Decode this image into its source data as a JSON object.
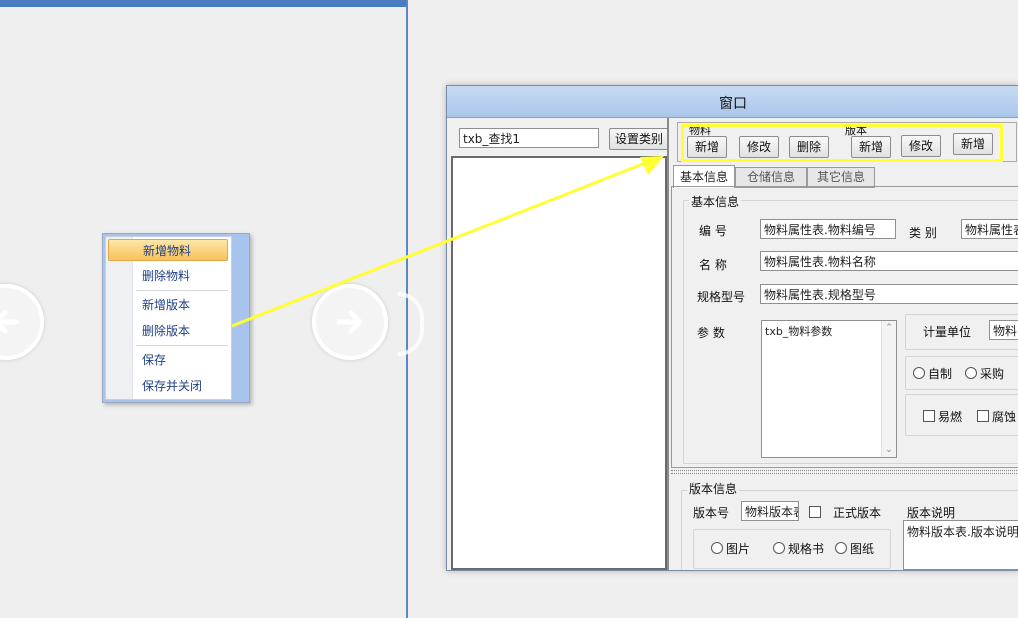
{
  "context_menu": {
    "items": [
      "新增物料",
      "删除物料",
      "新增版本",
      "删除版本",
      "保存",
      "保存并关闭"
    ]
  },
  "window": {
    "title": "窗口",
    "search_box": "txb_查找1",
    "set_category_button": "设置类别",
    "material_group": {
      "label": "物料",
      "add": "新增",
      "edit": "修改",
      "delete": "删除"
    },
    "version_group": {
      "label": "版本",
      "add": "新增",
      "edit": "修改",
      "add2": "新增"
    },
    "tabs": [
      "基本信息",
      "仓储信息",
      "其它信息"
    ],
    "basic_info": {
      "group_label": "基本信息",
      "code_label": "编  号",
      "code_value": "物料属性表.物料编号",
      "category_label": "类  别",
      "category_value": "物料属性表",
      "name_label": "名  称",
      "name_value": "物料属性表.物料名称",
      "spec_label": "规格型号",
      "spec_value": "物料属性表.规格型号",
      "param_label": "参  数",
      "param_value": "txb_物料参数",
      "unit_label": "计量单位",
      "unit_value": "物料",
      "radio_self": "自制",
      "radio_buy": "采购",
      "check_flammable": "易燃",
      "check_corrosive": "腐蚀"
    },
    "version_info": {
      "group_label": "版本信息",
      "version_no_label": "版本号",
      "version_no_value": "物料版本表",
      "official_label": "正式版本",
      "desc_label": "版本说明",
      "desc_value": "物料版本表.版本说明",
      "radio_image": "图片",
      "radio_spec": "规格书",
      "radio_drawing": "图纸"
    }
  },
  "colors": {
    "highlight": "#ffff33",
    "menu_text": "#1f3f85",
    "title_bar": "#b8d1f0"
  }
}
